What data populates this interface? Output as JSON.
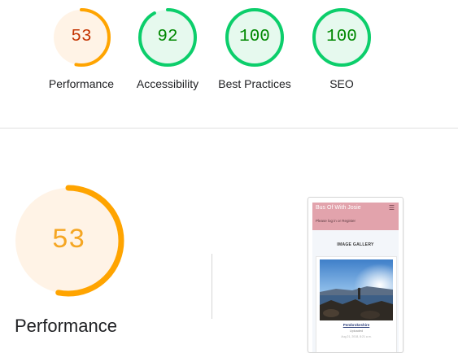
{
  "categories": [
    {
      "id": "performance",
      "score": "53",
      "score_value": 53,
      "label": "Performance",
      "status": "average"
    },
    {
      "id": "accessibility",
      "score": "92",
      "score_value": 92,
      "label": "Accessibility",
      "status": "pass"
    },
    {
      "id": "best_practices",
      "score": "100",
      "score_value": 100,
      "label": "Best Practices",
      "status": "pass"
    },
    {
      "id": "seo",
      "score": "100",
      "score_value": 100,
      "label": "SEO",
      "status": "pass"
    }
  ],
  "colors": {
    "average_arc": "#ffa400",
    "average_fill": "#fff3e6",
    "average_text": "#c33300",
    "pass_arc": "#0cce6b",
    "pass_fill": "#e6f9ee",
    "pass_text": "#008800",
    "big_text": "#f5a623"
  },
  "detail": {
    "score": "53",
    "score_value": 53,
    "label": "Performance"
  },
  "screenshot": {
    "site_title": "Bus Of With Josie",
    "menu_icon": "hamburger-icon",
    "login_text": "Please log in or Register",
    "gallery_title": "IMAGE GALLERY",
    "photo_title": "Pembrokeshire",
    "photo_subtitle": "Uploaded",
    "photo_date": "Aug 21, 2018, 8:21 a.m."
  }
}
